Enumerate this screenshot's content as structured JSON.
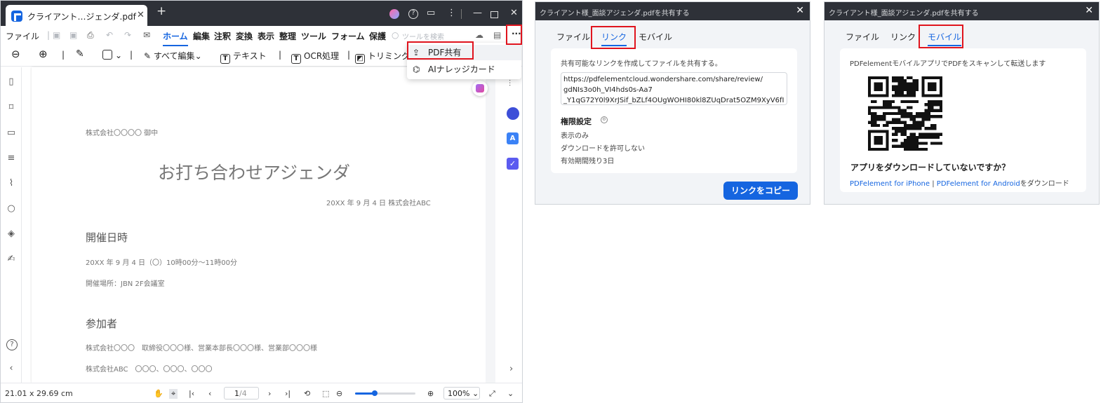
{
  "app": {
    "tab_title": "クライアント…ジェンダ.pdf",
    "menu": [
      "ファイル",
      "ホーム",
      "編集",
      "注釈",
      "変換",
      "表示",
      "整理",
      "ツール",
      "フォーム",
      "保護"
    ],
    "search_placeholder": "ツールを検索",
    "toolbar": {
      "edit_all": "すべて編集",
      "text": "テキスト",
      "ocr": "OCR処理",
      "trim": "トリミング"
    },
    "dropdown": {
      "share": "PDF共有",
      "ai_card": "AIナレッジカード"
    },
    "document": {
      "addressee": "株式会社〇〇〇〇 御中",
      "title": "お打ち合わせアジェンダ",
      "date_line": "20XX 年 9 月 4 日 株式会社ABC",
      "section1": "開催日時",
      "datetime": "20XX 年 9 月 4 日（〇）10時00分〜11時00分",
      "place": "開催場所：JBN 2F会議室",
      "section2": "参加者",
      "attendees1": "株式会社〇〇〇　取締役〇〇〇様、営業本部長〇〇〇様、営業部〇〇〇様",
      "attendees2": "株式会社ABC　〇〇〇、〇〇〇、〇〇〇"
    },
    "status": {
      "page_size": "21.01 x 29.69 cm",
      "page_current": "1",
      "page_total": "/4",
      "zoom": "100%"
    },
    "zoom_fraction": 0.33
  },
  "share_link_dialog": {
    "title": "クライアント様_面談アジェンダ.pdfを共有する",
    "tabs": [
      "ファイル",
      "リンク",
      "モバイル"
    ],
    "active_tab": "リンク",
    "description": "共有可能なリンクを作成してファイルを共有する。",
    "url_lines": [
      "https://pdfelementcloud.wondershare.com/share/review/",
      "gdNIs3o0h_VI4hds0s-Aa7",
      "_Y1qG72Y0l9XrJSif_bZLf4OUgWOHI80kl8ZUqDrat5OZM9XyV6fI"
    ],
    "permission_title": "権限設定",
    "permissions": [
      "表示のみ",
      "ダウンロードを許可しない",
      "有効期間残り3日"
    ],
    "copy_button": "リンクをコピー"
  },
  "share_mobile_dialog": {
    "title": "クライアント様_面談アジェンダ.pdfを共有する",
    "tabs": [
      "ファイル",
      "リンク",
      "モバイル"
    ],
    "active_tab": "モバイル",
    "description": "PDFelementモバイルアプリでPDFをスキャンして転送します",
    "question": "アプリをダウンロードしていないですか？",
    "iphone_link": "PDFelement for iPhone",
    "separator": "|",
    "android_link": "PDFelement for Android",
    "download_suffix": "をダウンロード"
  },
  "colors": {
    "accent": "#1565e0",
    "highlight": "#e0141e",
    "titlebar": "#2e3138"
  }
}
